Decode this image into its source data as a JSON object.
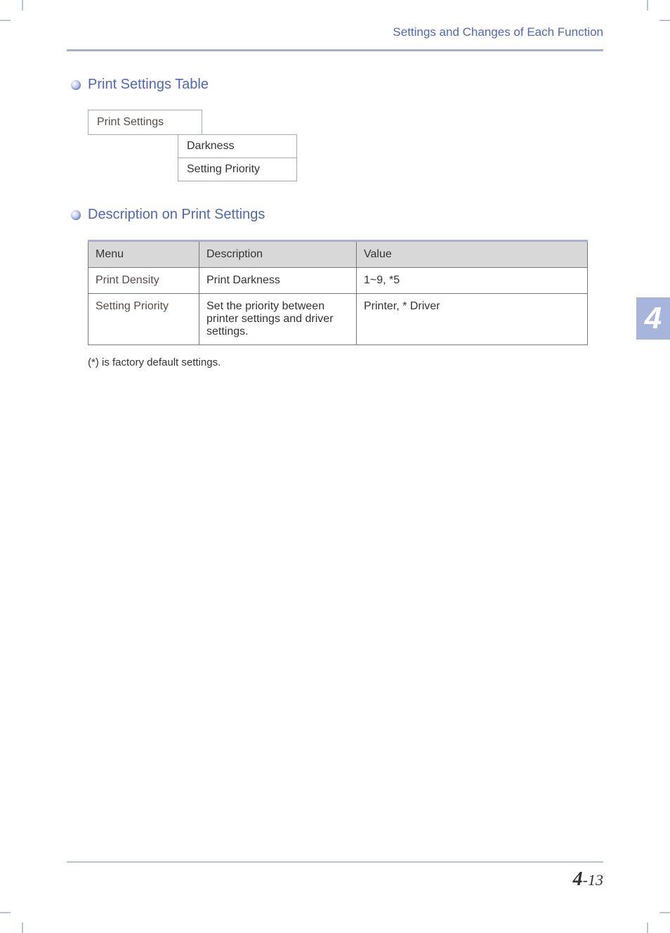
{
  "running_header": "Settings and Changes of Each Function",
  "sections": {
    "table": {
      "title": "Print Settings Table",
      "root": "Print Settings",
      "items": [
        "Darkness",
        "Setting Priority"
      ]
    },
    "description": {
      "title": "Description on Print Settings",
      "headers": {
        "menu": "Menu",
        "description": "Description",
        "value": "Value"
      },
      "rows": [
        {
          "menu": "Print Density",
          "description": "Print Darkness",
          "value": "1~9, *5"
        },
        {
          "menu": "Setting Priority",
          "description": "Set the priority between printer settings and driver settings.",
          "value": "Printer, * Driver"
        }
      ],
      "note": "(*) is factory default settings."
    }
  },
  "chapter_tab": "4",
  "footer": {
    "chapter": "4",
    "sep": "-",
    "page": "13"
  }
}
